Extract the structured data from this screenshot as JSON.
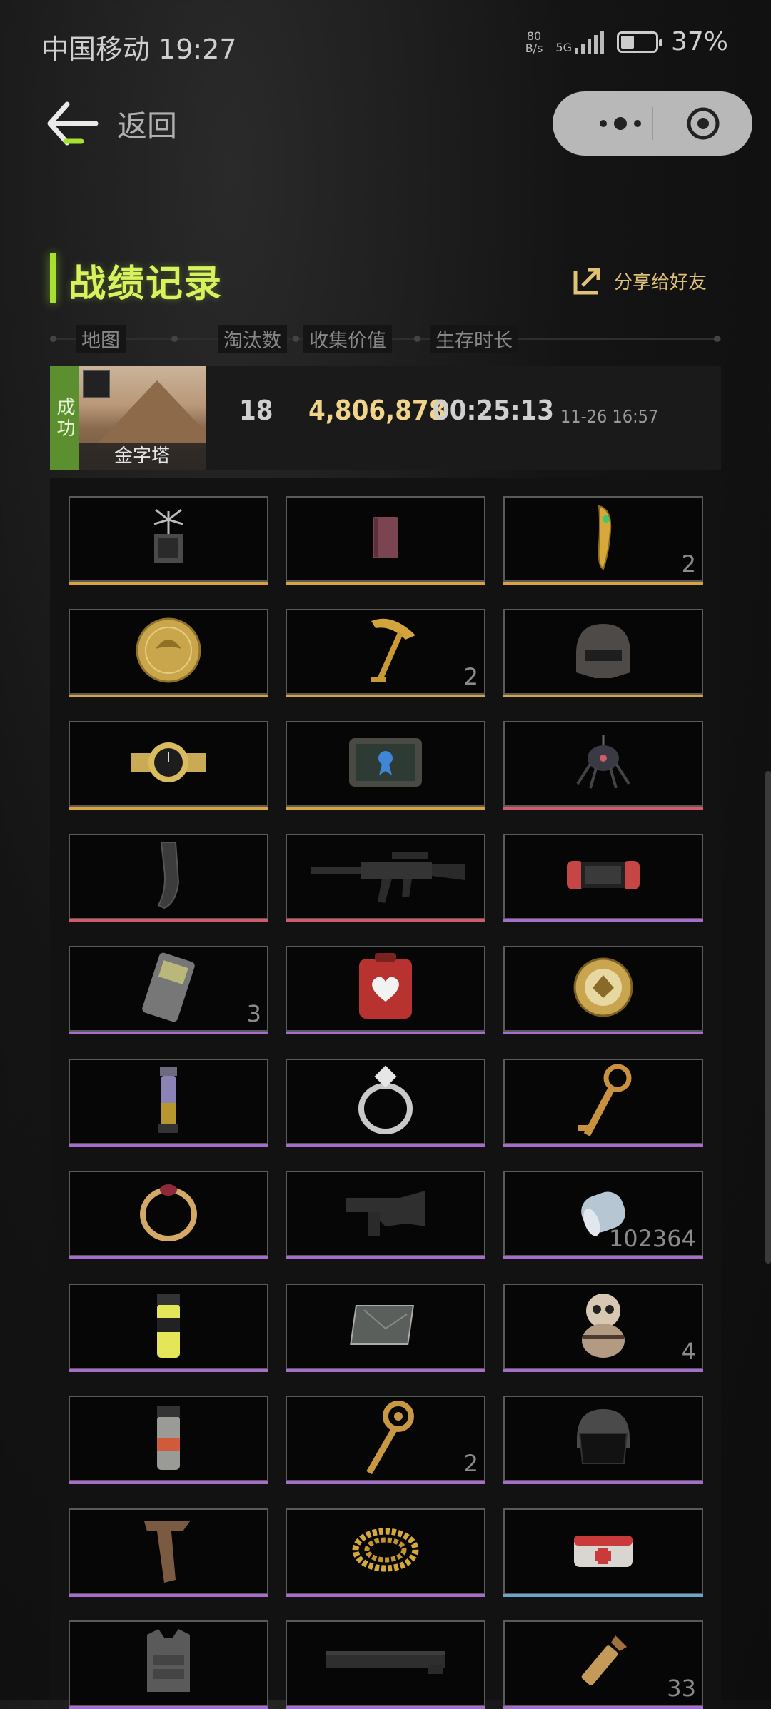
{
  "status_bar": {
    "carrier_time": "中国移动 19:27",
    "net_speed_value": "80",
    "net_speed_unit": "B/s",
    "net_type": "5G",
    "battery": "37%"
  },
  "nav": {
    "back_label": "返回"
  },
  "section": {
    "title": "战绩记录",
    "share_label": "分享给好友"
  },
  "columns": [
    "地图",
    "淘汰数",
    "收集价值",
    "生存时长"
  ],
  "match": {
    "result": "成功",
    "map_name": "金字塔",
    "eliminations": "18",
    "collected_value": "4,806,878",
    "survival_time": "00:25:13",
    "datetime": "11-26 16:57"
  },
  "items": [
    {
      "icon": "spider-drone-device-icon",
      "quantity": "",
      "rarity": "gold"
    },
    {
      "icon": "book-icon",
      "quantity": "",
      "rarity": "gold"
    },
    {
      "icon": "golden-amulet-icon",
      "quantity": "2",
      "rarity": "gold"
    },
    {
      "icon": "gold-coin-icon",
      "quantity": "",
      "rarity": "gold"
    },
    {
      "icon": "golden-key-icon",
      "quantity": "2",
      "rarity": "gold"
    },
    {
      "icon": "helmet-icon",
      "quantity": "",
      "rarity": "gold"
    },
    {
      "icon": "wristwatch-icon",
      "quantity": "",
      "rarity": "gold"
    },
    {
      "icon": "tablet-certificate-icon",
      "quantity": "",
      "rarity": "gold"
    },
    {
      "icon": "spider-robot-icon",
      "quantity": "",
      "rarity": "red"
    },
    {
      "icon": "magazine-icon",
      "quantity": "",
      "rarity": "red"
    },
    {
      "icon": "assault-rifle-icon",
      "quantity": "",
      "rarity": "red"
    },
    {
      "icon": "game-console-icon",
      "quantity": "",
      "rarity": "purple"
    },
    {
      "icon": "rangefinder-icon",
      "quantity": "3",
      "rarity": "purple"
    },
    {
      "icon": "defibrillator-icon",
      "quantity": "",
      "rarity": "purple"
    },
    {
      "icon": "medal-coin-icon",
      "quantity": "",
      "rarity": "purple"
    },
    {
      "icon": "vial-icon",
      "quantity": "",
      "rarity": "purple"
    },
    {
      "icon": "silver-ring-icon",
      "quantity": "",
      "rarity": "purple"
    },
    {
      "icon": "ornate-key-icon",
      "quantity": "",
      "rarity": "purple"
    },
    {
      "icon": "gold-ring-icon",
      "quantity": "",
      "rarity": "purple"
    },
    {
      "icon": "rifle-stock-icon",
      "quantity": "",
      "rarity": "purple"
    },
    {
      "icon": "tape-roll-icon",
      "quantity": "102364",
      "rarity": "purple"
    },
    {
      "icon": "smoke-grenade-icon",
      "quantity": "",
      "rarity": "purple"
    },
    {
      "icon": "glass-plate-icon",
      "quantity": "",
      "rarity": "purple"
    },
    {
      "icon": "figurine-icon",
      "quantity": "4",
      "rarity": "purple"
    },
    {
      "icon": "flashbang-icon",
      "quantity": "",
      "rarity": "purple"
    },
    {
      "icon": "round-key-icon",
      "quantity": "2",
      "rarity": "purple"
    },
    {
      "icon": "visor-helmet-icon",
      "quantity": "",
      "rarity": "purple"
    },
    {
      "icon": "foregrip-icon",
      "quantity": "",
      "rarity": "purple"
    },
    {
      "icon": "gold-chain-icon",
      "quantity": "",
      "rarity": "purple"
    },
    {
      "icon": "medkit-icon",
      "quantity": "",
      "rarity": "blue"
    },
    {
      "icon": "body-armor-icon",
      "quantity": "",
      "rarity": "purple"
    },
    {
      "icon": "handguard-rail-icon",
      "quantity": "",
      "rarity": "purple"
    },
    {
      "icon": "bullet-icon",
      "quantity": "33",
      "rarity": "purple"
    }
  ],
  "colors": {
    "accent": "#a6e12f",
    "title": "#d7f25c",
    "value_gold": "#f0d48a",
    "rarity_gold": "#d9a23a",
    "rarity_red": "#d65b6a",
    "rarity_purple": "#a86ccf",
    "rarity_blue": "#6aa6c8",
    "success_green": "#5c8f2f"
  }
}
